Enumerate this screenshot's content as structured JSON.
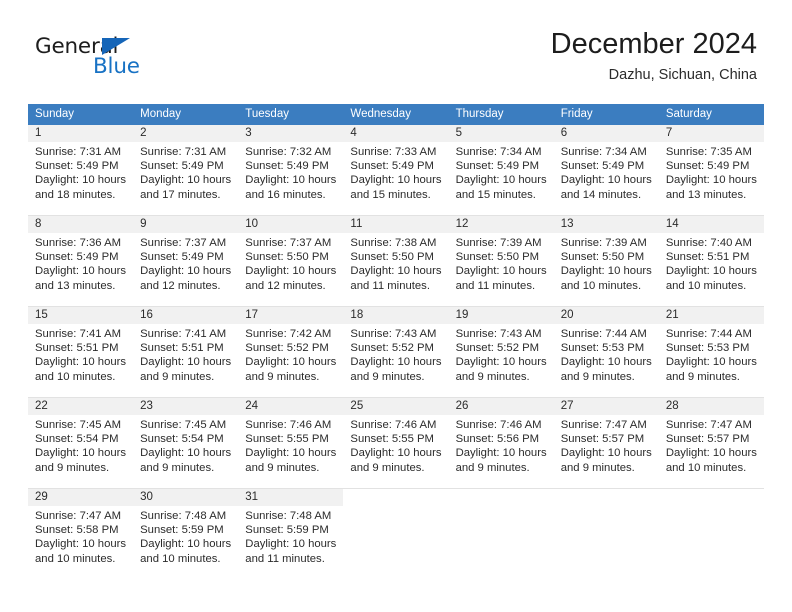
{
  "brand": {
    "name_part1": "General",
    "name_part2": "Blue",
    "triangle_color": "#1565b8",
    "blue_color": "#1872c4"
  },
  "header": {
    "title": "December 2024",
    "location": "Dazhu, Sichuan, China"
  },
  "theme": {
    "header_blue": "#3b7dc0",
    "daynum_bg": "#f1f1f1",
    "row_border": "#e2e2e2"
  },
  "weekdays": [
    "Sunday",
    "Monday",
    "Tuesday",
    "Wednesday",
    "Thursday",
    "Friday",
    "Saturday"
  ],
  "weeks": [
    [
      {
        "day": "1",
        "l1": "Sunrise: 7:31 AM",
        "l2": "Sunset: 5:49 PM",
        "l3": "Daylight: 10 hours",
        "l4": "and 18 minutes."
      },
      {
        "day": "2",
        "l1": "Sunrise: 7:31 AM",
        "l2": "Sunset: 5:49 PM",
        "l3": "Daylight: 10 hours",
        "l4": "and 17 minutes."
      },
      {
        "day": "3",
        "l1": "Sunrise: 7:32 AM",
        "l2": "Sunset: 5:49 PM",
        "l3": "Daylight: 10 hours",
        "l4": "and 16 minutes."
      },
      {
        "day": "4",
        "l1": "Sunrise: 7:33 AM",
        "l2": "Sunset: 5:49 PM",
        "l3": "Daylight: 10 hours",
        "l4": "and 15 minutes."
      },
      {
        "day": "5",
        "l1": "Sunrise: 7:34 AM",
        "l2": "Sunset: 5:49 PM",
        "l3": "Daylight: 10 hours",
        "l4": "and 15 minutes."
      },
      {
        "day": "6",
        "l1": "Sunrise: 7:34 AM",
        "l2": "Sunset: 5:49 PM",
        "l3": "Daylight: 10 hours",
        "l4": "and 14 minutes."
      },
      {
        "day": "7",
        "l1": "Sunrise: 7:35 AM",
        "l2": "Sunset: 5:49 PM",
        "l3": "Daylight: 10 hours",
        "l4": "and 13 minutes."
      }
    ],
    [
      {
        "day": "8",
        "l1": "Sunrise: 7:36 AM",
        "l2": "Sunset: 5:49 PM",
        "l3": "Daylight: 10 hours",
        "l4": "and 13 minutes."
      },
      {
        "day": "9",
        "l1": "Sunrise: 7:37 AM",
        "l2": "Sunset: 5:49 PM",
        "l3": "Daylight: 10 hours",
        "l4": "and 12 minutes."
      },
      {
        "day": "10",
        "l1": "Sunrise: 7:37 AM",
        "l2": "Sunset: 5:50 PM",
        "l3": "Daylight: 10 hours",
        "l4": "and 12 minutes."
      },
      {
        "day": "11",
        "l1": "Sunrise: 7:38 AM",
        "l2": "Sunset: 5:50 PM",
        "l3": "Daylight: 10 hours",
        "l4": "and 11 minutes."
      },
      {
        "day": "12",
        "l1": "Sunrise: 7:39 AM",
        "l2": "Sunset: 5:50 PM",
        "l3": "Daylight: 10 hours",
        "l4": "and 11 minutes."
      },
      {
        "day": "13",
        "l1": "Sunrise: 7:39 AM",
        "l2": "Sunset: 5:50 PM",
        "l3": "Daylight: 10 hours",
        "l4": "and 10 minutes."
      },
      {
        "day": "14",
        "l1": "Sunrise: 7:40 AM",
        "l2": "Sunset: 5:51 PM",
        "l3": "Daylight: 10 hours",
        "l4": "and 10 minutes."
      }
    ],
    [
      {
        "day": "15",
        "l1": "Sunrise: 7:41 AM",
        "l2": "Sunset: 5:51 PM",
        "l3": "Daylight: 10 hours",
        "l4": "and 10 minutes."
      },
      {
        "day": "16",
        "l1": "Sunrise: 7:41 AM",
        "l2": "Sunset: 5:51 PM",
        "l3": "Daylight: 10 hours",
        "l4": "and 9 minutes."
      },
      {
        "day": "17",
        "l1": "Sunrise: 7:42 AM",
        "l2": "Sunset: 5:52 PM",
        "l3": "Daylight: 10 hours",
        "l4": "and 9 minutes."
      },
      {
        "day": "18",
        "l1": "Sunrise: 7:43 AM",
        "l2": "Sunset: 5:52 PM",
        "l3": "Daylight: 10 hours",
        "l4": "and 9 minutes."
      },
      {
        "day": "19",
        "l1": "Sunrise: 7:43 AM",
        "l2": "Sunset: 5:52 PM",
        "l3": "Daylight: 10 hours",
        "l4": "and 9 minutes."
      },
      {
        "day": "20",
        "l1": "Sunrise: 7:44 AM",
        "l2": "Sunset: 5:53 PM",
        "l3": "Daylight: 10 hours",
        "l4": "and 9 minutes."
      },
      {
        "day": "21",
        "l1": "Sunrise: 7:44 AM",
        "l2": "Sunset: 5:53 PM",
        "l3": "Daylight: 10 hours",
        "l4": "and 9 minutes."
      }
    ],
    [
      {
        "day": "22",
        "l1": "Sunrise: 7:45 AM",
        "l2": "Sunset: 5:54 PM",
        "l3": "Daylight: 10 hours",
        "l4": "and 9 minutes."
      },
      {
        "day": "23",
        "l1": "Sunrise: 7:45 AM",
        "l2": "Sunset: 5:54 PM",
        "l3": "Daylight: 10 hours",
        "l4": "and 9 minutes."
      },
      {
        "day": "24",
        "l1": "Sunrise: 7:46 AM",
        "l2": "Sunset: 5:55 PM",
        "l3": "Daylight: 10 hours",
        "l4": "and 9 minutes."
      },
      {
        "day": "25",
        "l1": "Sunrise: 7:46 AM",
        "l2": "Sunset: 5:55 PM",
        "l3": "Daylight: 10 hours",
        "l4": "and 9 minutes."
      },
      {
        "day": "26",
        "l1": "Sunrise: 7:46 AM",
        "l2": "Sunset: 5:56 PM",
        "l3": "Daylight: 10 hours",
        "l4": "and 9 minutes."
      },
      {
        "day": "27",
        "l1": "Sunrise: 7:47 AM",
        "l2": "Sunset: 5:57 PM",
        "l3": "Daylight: 10 hours",
        "l4": "and 9 minutes."
      },
      {
        "day": "28",
        "l1": "Sunrise: 7:47 AM",
        "l2": "Sunset: 5:57 PM",
        "l3": "Daylight: 10 hours",
        "l4": "and 10 minutes."
      }
    ],
    [
      {
        "day": "29",
        "l1": "Sunrise: 7:47 AM",
        "l2": "Sunset: 5:58 PM",
        "l3": "Daylight: 10 hours",
        "l4": "and 10 minutes."
      },
      {
        "day": "30",
        "l1": "Sunrise: 7:48 AM",
        "l2": "Sunset: 5:59 PM",
        "l3": "Daylight: 10 hours",
        "l4": "and 10 minutes."
      },
      {
        "day": "31",
        "l1": "Sunrise: 7:48 AM",
        "l2": "Sunset: 5:59 PM",
        "l3": "Daylight: 10 hours",
        "l4": "and 11 minutes."
      },
      {
        "day": "",
        "l1": "",
        "l2": "",
        "l3": "",
        "l4": ""
      },
      {
        "day": "",
        "l1": "",
        "l2": "",
        "l3": "",
        "l4": ""
      },
      {
        "day": "",
        "l1": "",
        "l2": "",
        "l3": "",
        "l4": ""
      },
      {
        "day": "",
        "l1": "",
        "l2": "",
        "l3": "",
        "l4": ""
      }
    ]
  ]
}
